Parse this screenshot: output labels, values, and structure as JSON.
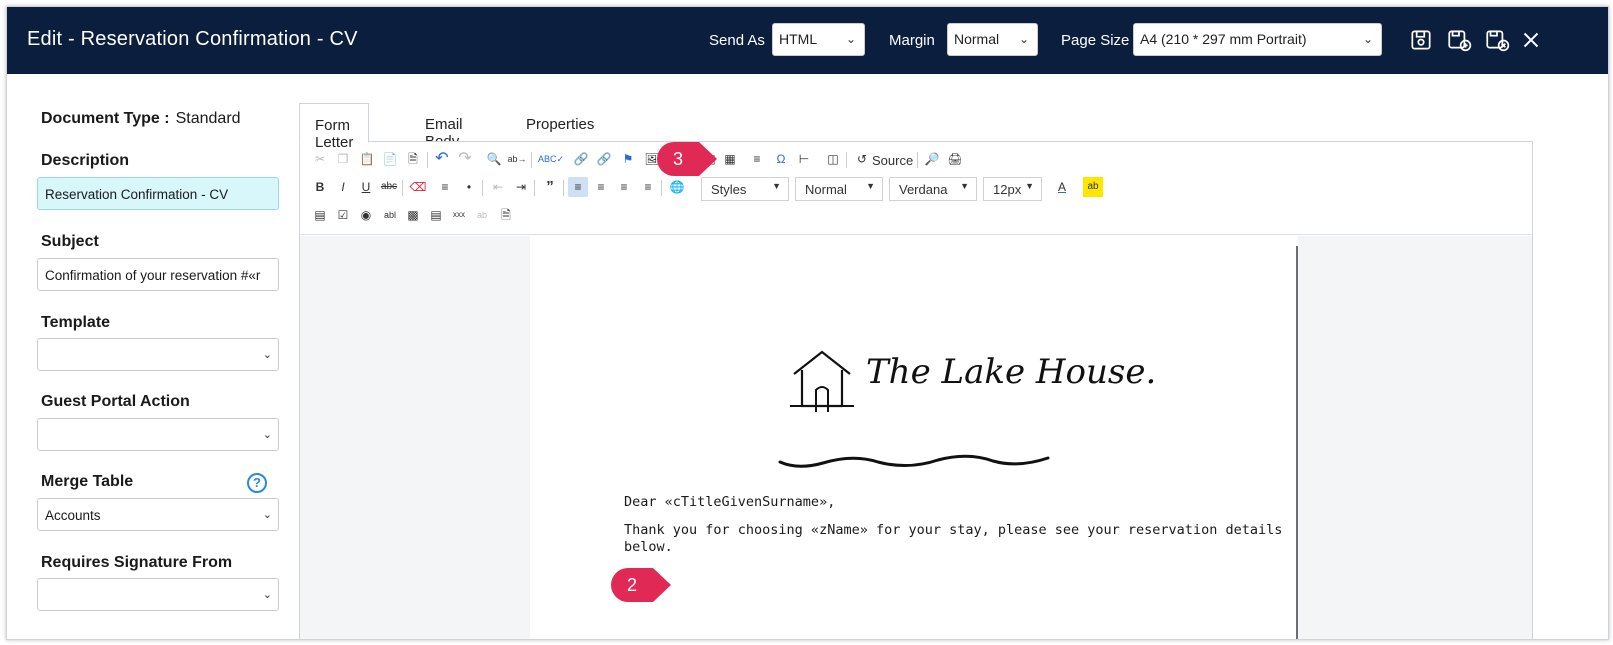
{
  "header": {
    "title": "Edit - Reservation Confirmation - CV",
    "send_as_label": "Send As",
    "send_as_value": "HTML",
    "margin_label": "Margin",
    "margin_value": "Normal",
    "page_size_label": "Page Size",
    "page_size_value": "A4 (210 * 297 mm Portrait)",
    "icons": [
      "save-icon",
      "save-new-icon",
      "save-close-icon",
      "close-icon"
    ]
  },
  "left": {
    "document_type_label": "Document Type :",
    "document_type_value": "Standard",
    "description_label": "Description",
    "description_value": "Reservation Confirmation - CV",
    "subject_label": "Subject",
    "subject_value": "Confirmation of your reservation #«r",
    "template_label": "Template",
    "template_value": "",
    "guest_portal_label": "Guest Portal Action",
    "guest_portal_value": "",
    "merge_table_label": "Merge Table",
    "merge_table_value": "Accounts",
    "requires_signature_label": "Requires Signature From",
    "requires_signature_value": ""
  },
  "tabs": [
    "Form Letter",
    "Email Body",
    "Properties"
  ],
  "toolbar": {
    "source_label": "Source",
    "styles_value": "Styles",
    "format_value": "Normal",
    "font_value": "Verdana",
    "size_value": "12px"
  },
  "letter": {
    "logo_text": "The Lake House.",
    "greeting": "Dear «cTitleGivenSurname»,",
    "body_line1": "Thank you for choosing «zName» for your stay, please see your reservation details",
    "body_line2": "below."
  },
  "badges": {
    "step2": "2",
    "step3": "3"
  },
  "colors": {
    "header_bg": "#0b1e3d",
    "badge": "#e02a55",
    "highlight_input": "#d7f7fb",
    "help_icon": "#2b8ad8"
  }
}
